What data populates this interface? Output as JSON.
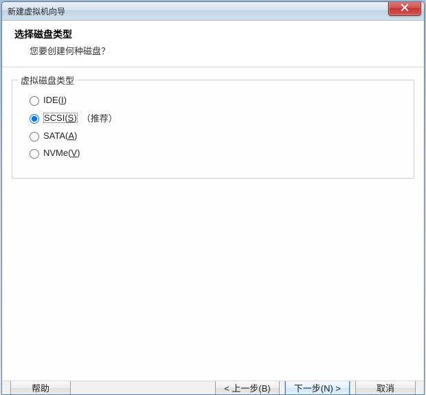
{
  "window": {
    "title": "新建虚拟机向导"
  },
  "header": {
    "title": "选择磁盘类型",
    "subtitle": "您要创建何种磁盘？"
  },
  "group": {
    "legend": "虚拟磁盘类型",
    "options": [
      {
        "label_pre": "IDE(",
        "accel": "I",
        "label_post": ")",
        "hint": "",
        "checked": false
      },
      {
        "label_pre": "SCSI(",
        "accel": "S",
        "label_post": ")",
        "hint": "（推荐）",
        "checked": true
      },
      {
        "label_pre": "SATA(",
        "accel": "A",
        "label_post": ")",
        "hint": "",
        "checked": false
      },
      {
        "label_pre": "NVMe(",
        "accel": "V",
        "label_post": ")",
        "hint": "",
        "checked": false
      }
    ]
  },
  "buttons": {
    "help": "帮助",
    "back": "< 上一步(B)",
    "next": "下一步(N) >",
    "cancel": "取消"
  }
}
